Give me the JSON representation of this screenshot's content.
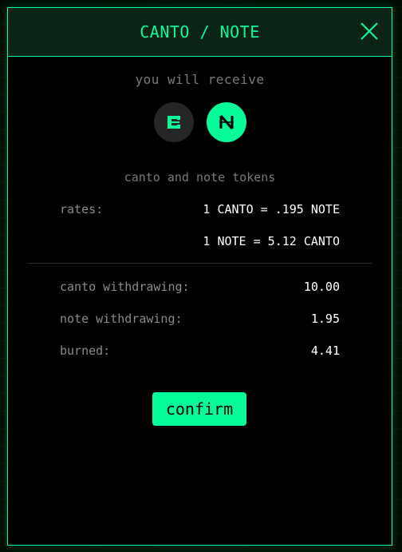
{
  "modal": {
    "title": "CANTO / NOTE",
    "subtitle": "you will receive",
    "tokens_text": "canto and note tokens",
    "icons": [
      "canto-token-icon",
      "note-token-icon",
      "close-icon"
    ],
    "rates": {
      "label": "rates:",
      "rate_1": "1 CANTO = .195 NOTE",
      "rate_2": "1 NOTE = 5.12 CANTO"
    },
    "withdraw": [
      {
        "label": "canto withdrawing:",
        "value": "10.00"
      },
      {
        "label": "note withdrawing:",
        "value": "1.95"
      },
      {
        "label": "burned:",
        "value": "4.41"
      }
    ],
    "confirm_label": "confirm"
  },
  "colors": {
    "accent": "#06fc99",
    "background": "#000000",
    "header_bg": "#0c2418",
    "muted_text": "#7a7a7a"
  }
}
